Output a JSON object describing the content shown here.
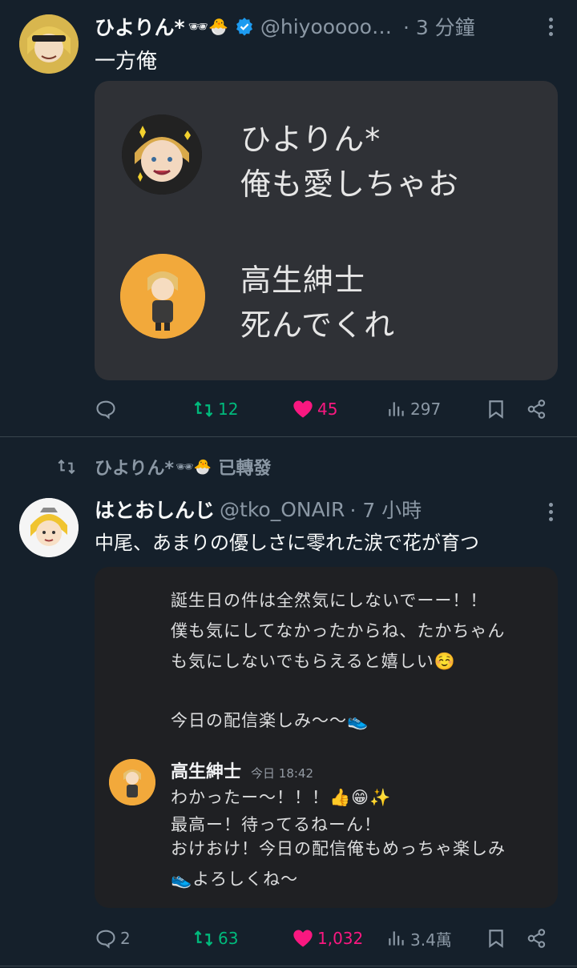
{
  "post1": {
    "display_name": "ひよりん*",
    "name_emojis": "🕶🐣",
    "handle": "@hiyooooo…",
    "time": "· 3 分鐘",
    "text": "一方俺",
    "card": {
      "msg1_name": "ひよりん*",
      "msg1_text": "俺も愛しちゃお",
      "msg2_name": "高生紳士",
      "msg2_text": "死んでくれ"
    },
    "actions": {
      "reply": "",
      "retweet": "12",
      "like": "45",
      "views": "297"
    }
  },
  "repost_bar": {
    "name": "ひよりん*",
    "emojis": "🕶🐣",
    "label": "已轉發"
  },
  "post2": {
    "display_name": "はとおしんじ",
    "handle": "@tko_ONAIR",
    "time": "· 7 小時",
    "text": "中尾、あまりの優しさに零れた涙で花が育つ",
    "card": {
      "line1": "誕生日の件は全然気にしないでーー！！",
      "line2": "僕も気にしてなかったからね、たかちゃん",
      "line3": "も気にしないでもらえると嬉しい☺️",
      "line4": "今日の配信楽しみ〜〜👟",
      "reply_name": "高生紳士",
      "reply_time": "今日 18:42",
      "reply1": "わかったー〜！！！👍😁✨",
      "reply2": "最高ー！待ってるねーん！",
      "reply3": "おけおけ！今日の配信俺もめっちゃ楽しみ",
      "reply4": "👟よろしくね〜"
    },
    "actions": {
      "reply": "2",
      "retweet": "63",
      "like": "1,032",
      "views": "3.4萬"
    }
  },
  "colors": {
    "background": "#15202b",
    "retweet": "#00ba7c",
    "like": "#f91880",
    "verified": "#1d9bf0"
  }
}
